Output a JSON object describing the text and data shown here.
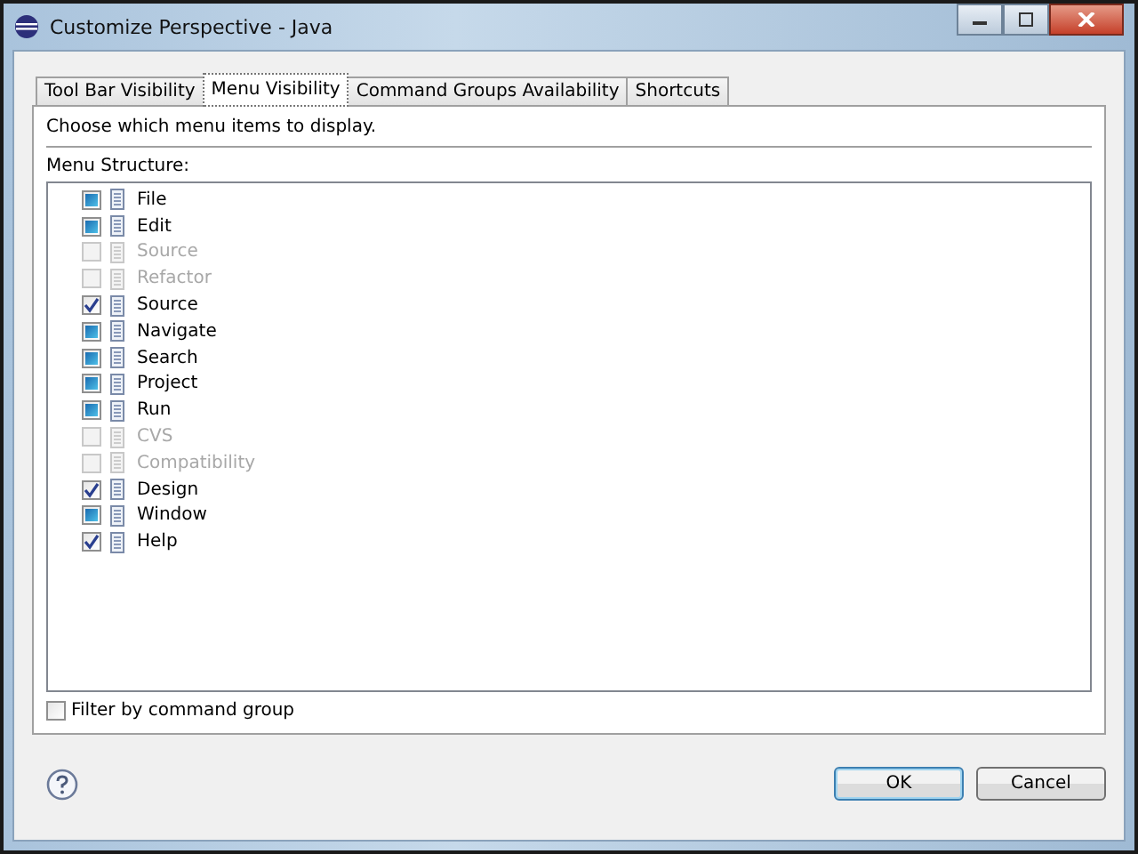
{
  "window": {
    "title": "Customize Perspective - Java"
  },
  "tabs": [
    {
      "label": "Tool Bar Visibility",
      "selected": false
    },
    {
      "label": "Menu Visibility",
      "selected": true
    },
    {
      "label": "Command Groups Availability",
      "selected": false
    },
    {
      "label": "Shortcuts",
      "selected": false
    }
  ],
  "description": "Choose which menu items to display.",
  "tree_label": "Menu Structure:",
  "menu_items": [
    {
      "label": "File",
      "checked": true,
      "grayed": true,
      "disabled": false
    },
    {
      "label": "Edit",
      "checked": true,
      "grayed": true,
      "disabled": false
    },
    {
      "label": "Source",
      "checked": false,
      "grayed": false,
      "disabled": true
    },
    {
      "label": "Refactor",
      "checked": false,
      "grayed": false,
      "disabled": true
    },
    {
      "label": "Source",
      "checked": true,
      "grayed": false,
      "disabled": false
    },
    {
      "label": "Navigate",
      "checked": true,
      "grayed": true,
      "disabled": false
    },
    {
      "label": "Search",
      "checked": true,
      "grayed": true,
      "disabled": false
    },
    {
      "label": "Project",
      "checked": true,
      "grayed": true,
      "disabled": false
    },
    {
      "label": "Run",
      "checked": true,
      "grayed": true,
      "disabled": false
    },
    {
      "label": "CVS",
      "checked": false,
      "grayed": false,
      "disabled": true
    },
    {
      "label": "Compatibility",
      "checked": false,
      "grayed": false,
      "disabled": true
    },
    {
      "label": "Design",
      "checked": true,
      "grayed": false,
      "disabled": false
    },
    {
      "label": "Window",
      "checked": true,
      "grayed": true,
      "disabled": false
    },
    {
      "label": "Help",
      "checked": true,
      "grayed": false,
      "disabled": false
    }
  ],
  "filter": {
    "label": "Filter by command group",
    "checked": false
  },
  "buttons": [
    {
      "label": "OK",
      "default": true
    },
    {
      "label": "Cancel",
      "default": false
    }
  ]
}
